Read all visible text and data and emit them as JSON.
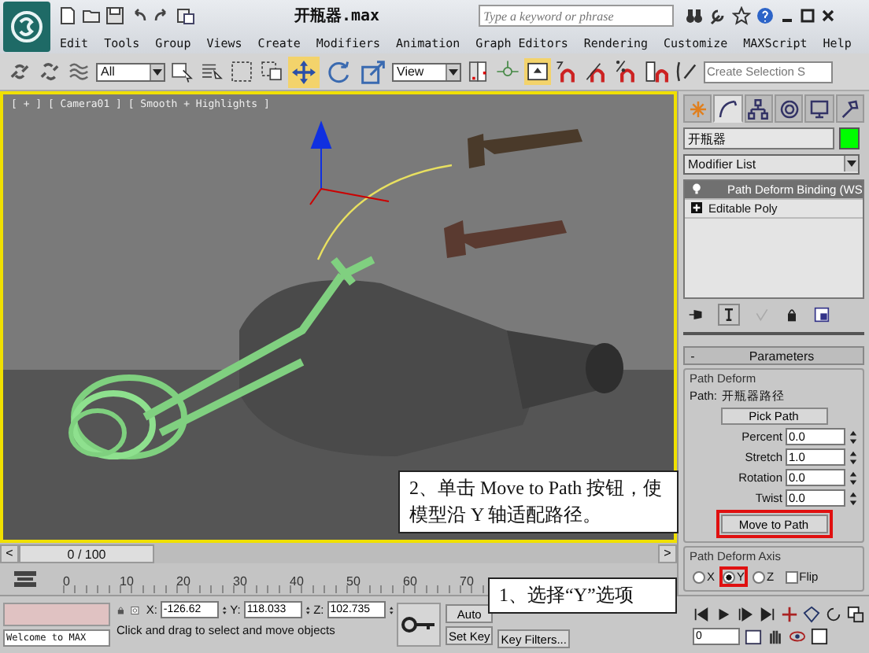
{
  "window": {
    "title": "开瓶器.max"
  },
  "search": {
    "placeholder": "Type a keyword or phrase"
  },
  "menu": [
    "Edit",
    "Tools",
    "Group",
    "Views",
    "Create",
    "Modifiers",
    "Animation",
    "Graph Editors",
    "Rendering",
    "Customize",
    "MAXScript",
    "Help"
  ],
  "toolbar": {
    "selection_filter": "All",
    "reference_coord": "View",
    "named_selection": "Create Selection S",
    "tools": [
      {
        "kind": "move",
        "selected": true
      },
      {
        "kind": "rotate",
        "selected": false
      },
      {
        "kind": "scale",
        "selected": false
      }
    ]
  },
  "viewport": {
    "label": "[ + ] [ Camera01 ] [ Smooth + Highlights ]"
  },
  "time_slider": {
    "prev": "<",
    "position": "0 / 100",
    "next": ">",
    "level": 0
  },
  "trackbar": {
    "ticks": [
      "0",
      "10",
      "20",
      "30",
      "40",
      "50",
      "60",
      "70"
    ]
  },
  "command_panel": {
    "tabs": [
      {
        "kind": "create",
        "selected": false
      },
      {
        "kind": "modify",
        "selected": true
      },
      {
        "kind": "hierarchy",
        "selected": false
      },
      {
        "kind": "motion",
        "selected": false
      },
      {
        "kind": "display",
        "selected": false
      },
      {
        "kind": "utilities",
        "selected": false
      }
    ],
    "object_name": "开瓶器",
    "modifier_list": "Modifier List",
    "stack": [
      {
        "label": "Path Deform Binding (WS",
        "kind": "modifier",
        "selected": true
      },
      {
        "label": "Editable Poly",
        "kind": "base",
        "selected": false
      }
    ],
    "rollout": {
      "title": "Parameters",
      "collapse": "-",
      "group": "Path Deform",
      "path_label": "Path:",
      "path_value": "开瓶器路径",
      "pick_button": "Pick Path",
      "spinners": [
        {
          "label": "Percent",
          "value": "0.0"
        },
        {
          "label": "Stretch",
          "value": "1.0"
        },
        {
          "label": "Rotation",
          "value": "0.0"
        },
        {
          "label": "Twist",
          "value": "0.0"
        }
      ],
      "move_button": {
        "label": "Move to Path",
        "highlighted": true
      },
      "axis_group": "Path Deform Axis",
      "axes": [
        {
          "label": "X",
          "selected": false,
          "highlighted": false
        },
        {
          "label": "Y",
          "selected": true,
          "highlighted": true
        },
        {
          "label": "Z",
          "selected": false,
          "highlighted": false
        }
      ],
      "flip": {
        "label": "Flip",
        "checked": false
      }
    }
  },
  "status": {
    "welcome": "Welcome to MAX",
    "prompt": "Click and drag to select and move objects",
    "coords": [
      {
        "axis": "X:",
        "value": "-126.62"
      },
      {
        "axis": "Y:",
        "value": "118.033"
      },
      {
        "axis": "Z:",
        "value": "102.735"
      }
    ],
    "auto_key": "Auto",
    "set_key": "Set Key",
    "key_filters": "Key Filters...",
    "frame": "0"
  },
  "callouts": [
    {
      "text": "2、单击 Move to Path 按钮，使模型沿 Y 轴适配路径。"
    },
    {
      "text": "1、选择“Y”选项"
    }
  ]
}
